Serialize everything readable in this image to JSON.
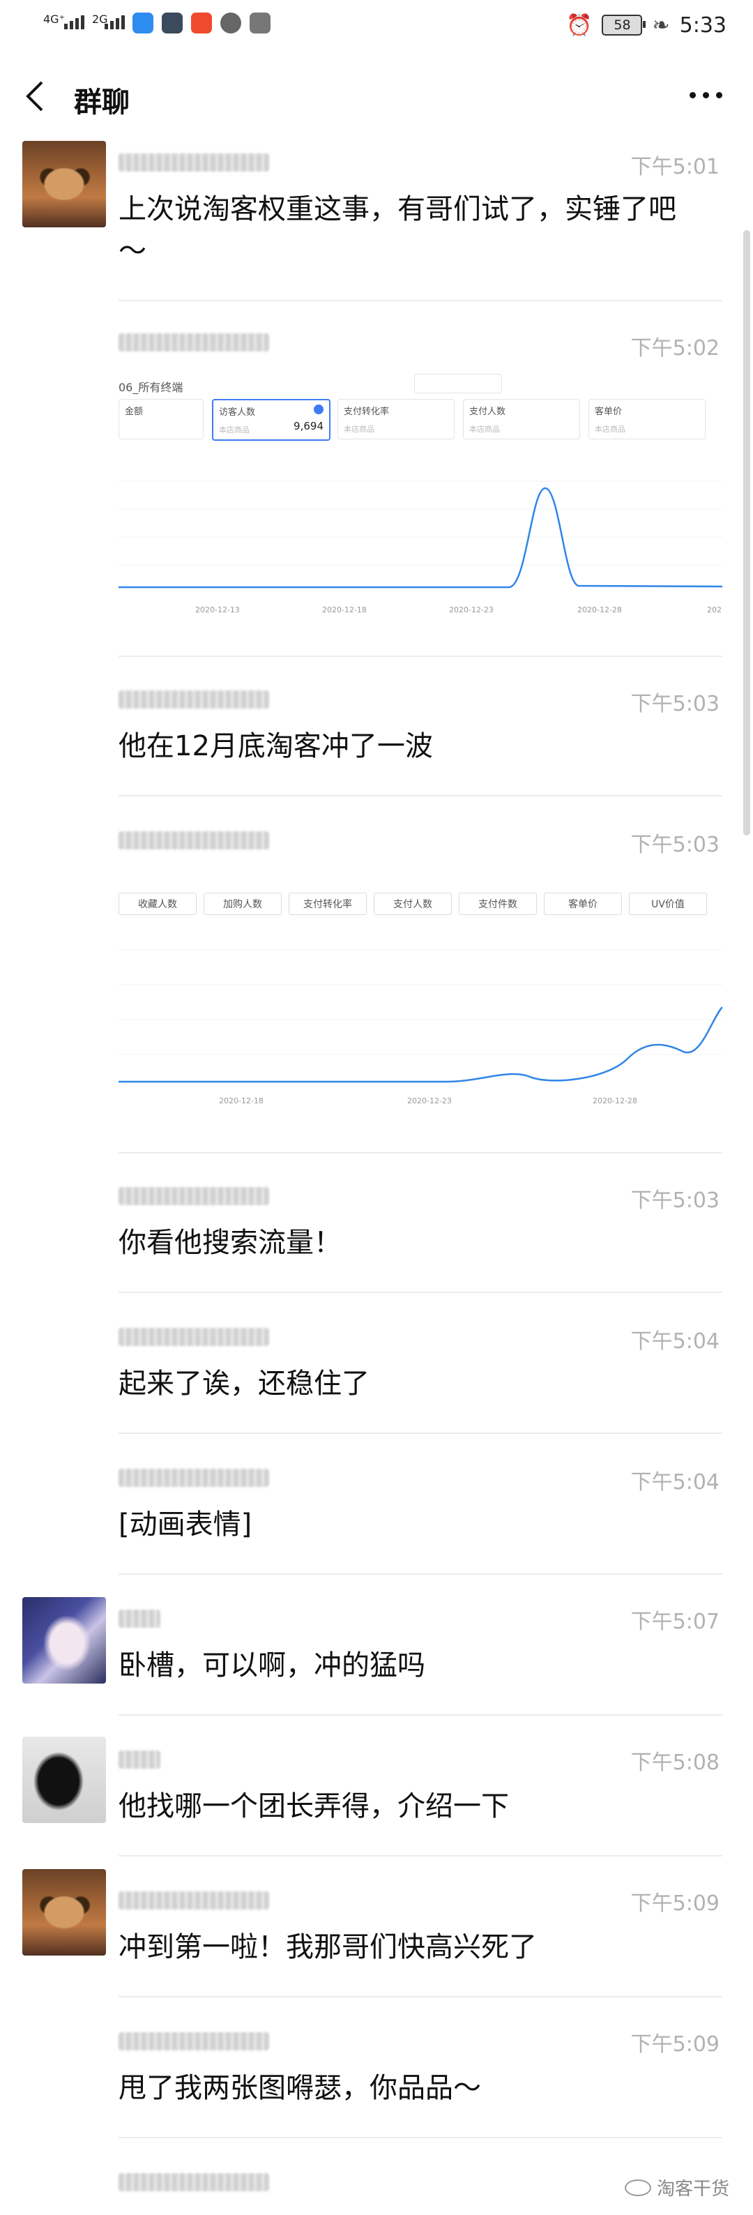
{
  "status_bar": {
    "network1": "4G⁺",
    "network2": "2G",
    "battery": "58",
    "time": "5:33"
  },
  "nav": {
    "title": "群聊"
  },
  "chart1": {
    "scope": "06_所有终端",
    "cards": [
      {
        "label": "金额",
        "value": ""
      },
      {
        "label": "访客人数",
        "value": "9,694",
        "sub": "本店商品"
      },
      {
        "label": "支付转化率",
        "value": "",
        "sub": "本店商品"
      },
      {
        "label": "支付人数",
        "value": "",
        "sub": "本店商品"
      },
      {
        "label": "客单价",
        "value": "",
        "sub": "本店商品"
      }
    ],
    "ticks": [
      "2020-12-13",
      "2020-12-18",
      "2020-12-23",
      "2020-12-28",
      "202"
    ]
  },
  "chart2": {
    "buttons": [
      "收藏人数",
      "加购人数",
      "支付转化率",
      "支付人数",
      "支付件数",
      "客单价",
      "UV价值"
    ],
    "ticks": [
      "2020-12-18",
      "2020-12-23",
      "2020-12-28"
    ]
  },
  "messages": [
    {
      "time": "下午5:01",
      "text": "上次说淘客权重这事，有哥们试了，实锤了吧～"
    },
    {
      "time": "下午5:02"
    },
    {
      "time": "下午5:03",
      "text": "他在12月底淘客冲了一波"
    },
    {
      "time": "下午5:03"
    },
    {
      "time": "下午5:03",
      "text": "你看他搜索流量！"
    },
    {
      "time": "下午5:04",
      "text": "起来了诶，还稳住了"
    },
    {
      "time": "下午5:04",
      "text": "[动画表情]"
    },
    {
      "time": "下午5:07",
      "text": "卧槽，可以啊，冲的猛吗"
    },
    {
      "time": "下午5:08",
      "text": "他找哪一个团长弄得，介绍一下"
    },
    {
      "time": "下午5:09",
      "text": "冲到第一啦！我那哥们快高兴死了"
    },
    {
      "time": "下午5:09",
      "text": "甩了我两张图嘚瑟，你品品～"
    }
  ],
  "watermark": "淘客干货"
}
